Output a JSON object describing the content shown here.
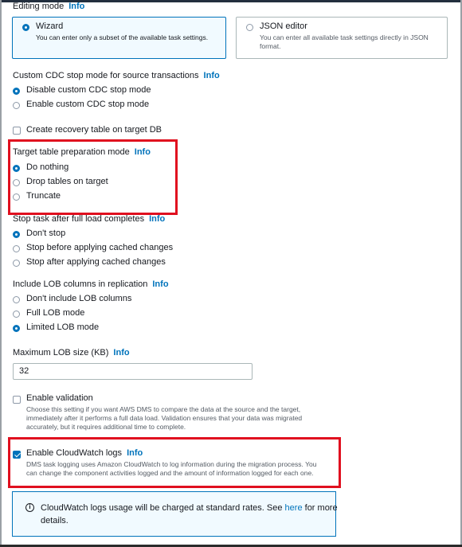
{
  "editing_mode": {
    "label": "Editing mode",
    "info": "Info",
    "wizard": {
      "title": "Wizard",
      "description": "You can enter only a subset of the available task settings."
    },
    "json_editor": {
      "title": "JSON editor",
      "description_line1": "You can enter all available task settings directly in JSON",
      "description_line2": "format."
    }
  },
  "cdc_stop": {
    "label": "Custom CDC stop mode for source transactions",
    "info": "Info",
    "options": [
      "Disable custom CDC stop mode",
      "Enable custom CDC stop mode"
    ],
    "selected": 0
  },
  "recovery_table": {
    "label": "Create recovery table on target DB",
    "checked": false
  },
  "target_prep": {
    "label": "Target table preparation mode",
    "info": "Info",
    "options": [
      "Do nothing",
      "Drop tables on target",
      "Truncate"
    ],
    "selected": 0
  },
  "stop_task": {
    "label": "Stop task after full load completes",
    "info": "Info",
    "options": [
      "Don't stop",
      "Stop before applying cached changes",
      "Stop after applying cached changes"
    ],
    "selected": 0
  },
  "lob": {
    "label": "Include LOB columns in replication",
    "info": "Info",
    "options": [
      "Don't include LOB columns",
      "Full LOB mode",
      "Limited LOB mode"
    ],
    "selected": 2
  },
  "max_lob": {
    "label": "Maximum LOB size (KB)",
    "info": "Info",
    "value": "32"
  },
  "validation": {
    "label": "Enable validation",
    "checked": false,
    "desc_line1": "Choose this setting if you want AWS DMS to compare the data at the source and the target,",
    "desc_line2": "immediately after it performs a full data load. Validation ensures that your data was migrated",
    "desc_line3": "accurately, but it requires additional time to complete."
  },
  "cloudwatch": {
    "label": "Enable CloudWatch logs",
    "info": "Info",
    "checked": true,
    "desc_line1": "DMS task logging uses Amazon CloudWatch to log information during the migration process. You",
    "desc_line2": "can change the component activities logged and the amount of information logged for each one."
  },
  "notice": {
    "text_before": "CloudWatch logs usage will be charged at standard rates. See ",
    "link": "here",
    "text_after": " for more",
    "line2": "details."
  },
  "colors": {
    "accent": "#0073bb",
    "highlight": "#e0101f"
  }
}
